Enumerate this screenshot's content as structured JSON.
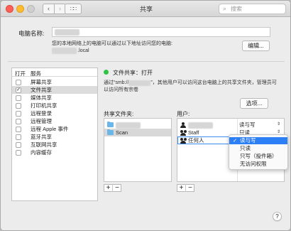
{
  "window": {
    "title": "共享"
  },
  "search": {
    "placeholder": "搜索"
  },
  "computer": {
    "label": "电脑名称:",
    "name_value": "MacBook",
    "hint": "您的本地网络上的电脑可以通过以下地址访问您的电脑:",
    "local_host": "MacBook",
    "local_suffix": ".local",
    "edit_label": "编辑..."
  },
  "services": {
    "col_on": "打开",
    "col_service": "服务",
    "items": [
      {
        "label": "屏幕共享",
        "checked": false
      },
      {
        "label": "文件共享",
        "checked": true
      },
      {
        "label": "媒体共享",
        "checked": false
      },
      {
        "label": "打印机共享",
        "checked": false
      },
      {
        "label": "远程登录",
        "checked": false
      },
      {
        "label": "远程管理",
        "checked": false
      },
      {
        "label": "远程 Apple 事件",
        "checked": false
      },
      {
        "label": "蓝牙共享",
        "checked": false
      },
      {
        "label": "互联网共享",
        "checked": false
      },
      {
        "label": "内容缓存",
        "checked": false
      }
    ]
  },
  "status": {
    "text": "文件共享：打开",
    "desc_prefix": "通过“smb://",
    "desc_host": "MacBook",
    "desc_suffix": "”，其他用户可以访问这台电脑上的共享文件夹，管理员可以访问所有宗卷",
    "status_color": "#2fc243"
  },
  "options_label": "选项...",
  "folders": {
    "label": "共享文件夹:",
    "items": [
      {
        "name": "MacBook",
        "blurred": true
      },
      {
        "name": "Scan",
        "blurred": false
      }
    ]
  },
  "users": {
    "label": "用户:",
    "items": [
      {
        "name": "MacBook",
        "blurred": true,
        "permission": "读与写",
        "icon": "user-icon"
      },
      {
        "name": "Staff",
        "blurred": false,
        "permission": "只读",
        "icon": "group-icon"
      },
      {
        "name": "任何人",
        "blurred": false,
        "permission": "读与写",
        "icon": "group-icon"
      }
    ]
  },
  "permission_menu": {
    "items": [
      "读与写",
      "只读",
      "只写（投件箱）",
      "无访问权限"
    ],
    "selected_index": 0,
    "check": "✓"
  },
  "buttons": {
    "plus": "+",
    "minus": "−",
    "help": "?"
  },
  "accent_color": "#2c7ff4"
}
